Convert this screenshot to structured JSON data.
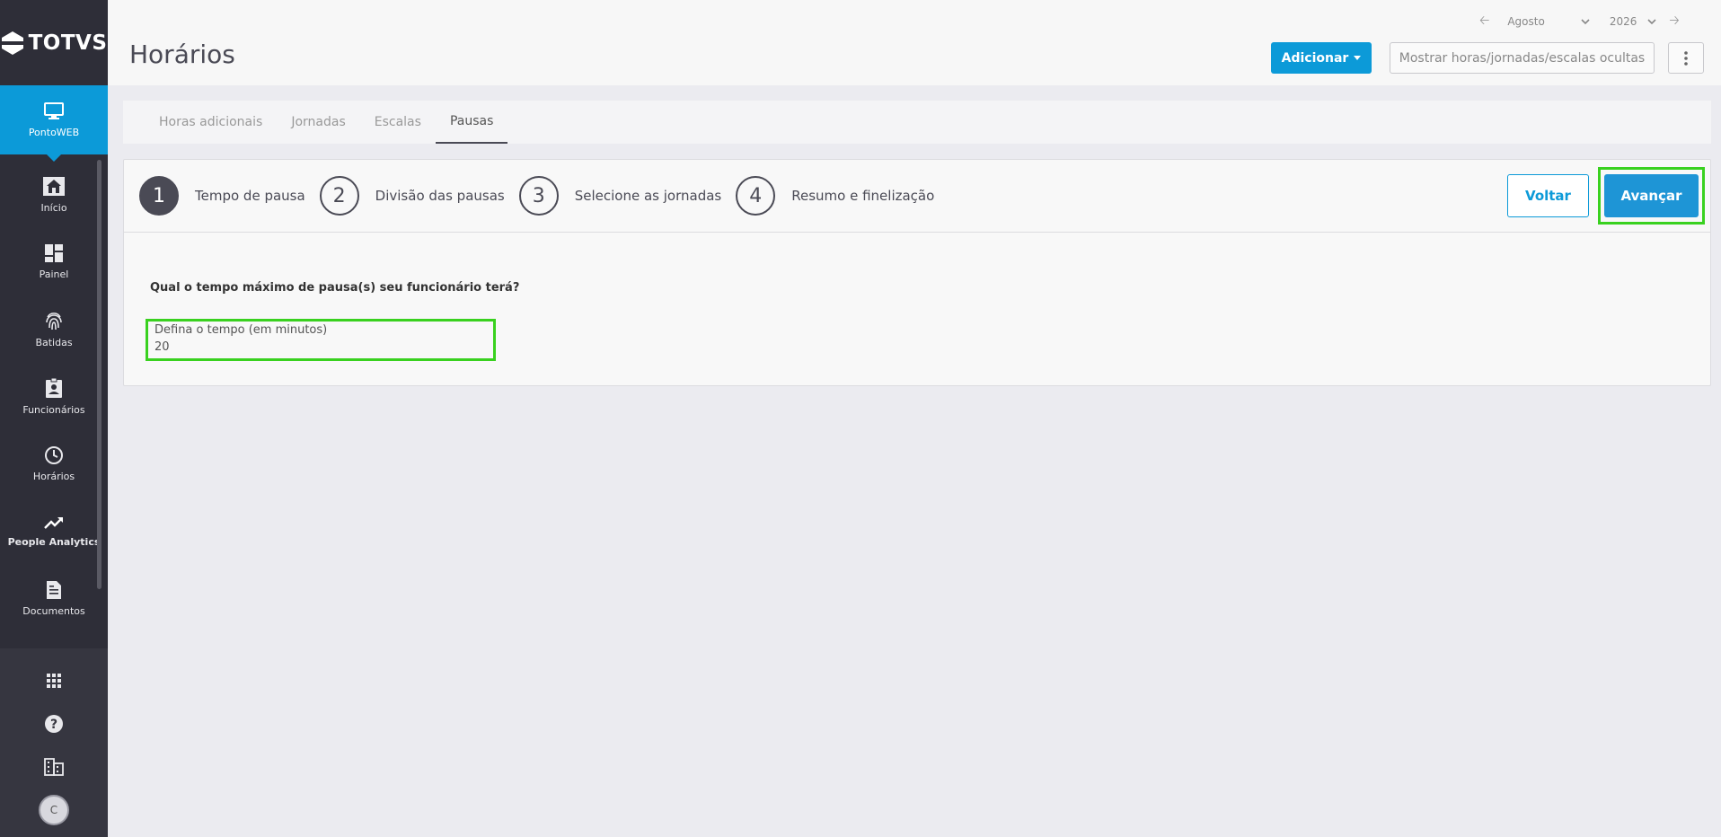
{
  "brand": {
    "logo_text": "TOTVS"
  },
  "sidebar": {
    "active_module": {
      "label": "PontoWEB",
      "icon": "monitor-icon"
    },
    "items": [
      {
        "label": "Início",
        "icon": "home-icon"
      },
      {
        "label": "Painel",
        "icon": "dashboard-icon"
      },
      {
        "label": "Batidas",
        "icon": "fingerprint-icon"
      },
      {
        "label": "Funcionários",
        "icon": "badge-icon"
      },
      {
        "label": "Horários",
        "icon": "clock-icon"
      },
      {
        "label": "People Analytics",
        "icon": "trending-up-icon"
      },
      {
        "label": "Documentos",
        "icon": "document-icon"
      }
    ],
    "bottom_icons": [
      "apps-grid-icon",
      "help-icon",
      "building-icon"
    ],
    "avatar_initial": "C"
  },
  "header": {
    "title": "Horários",
    "period": {
      "month": "Agosto",
      "year": "2026"
    },
    "add_button": "Adicionar",
    "show_hidden_button": "Mostrar horas/jornadas/escalas ocultas"
  },
  "tabs": [
    {
      "label": "Horas adicionais",
      "active": false
    },
    {
      "label": "Jornadas",
      "active": false
    },
    {
      "label": "Escalas",
      "active": false
    },
    {
      "label": "Pausas",
      "active": true
    }
  ],
  "wizard": {
    "steps": [
      {
        "number": "1",
        "label": "Tempo de pausa",
        "active": true
      },
      {
        "number": "2",
        "label": "Divisão das pausas",
        "active": false
      },
      {
        "number": "3",
        "label": "Selecione as jornadas",
        "active": false
      },
      {
        "number": "4",
        "label": "Resumo e finelização",
        "active": false
      }
    ],
    "back_button": "Voltar",
    "next_button": "Avançar",
    "question": "Qual o tempo máximo de pausa(s) seu funcionário terá?",
    "field": {
      "label": "Defina o tempo (em minutos)",
      "value": "20"
    }
  },
  "colors": {
    "accent": "#0c9ad8",
    "sidebar": "#2e2e38",
    "highlight": "#39d11f"
  }
}
